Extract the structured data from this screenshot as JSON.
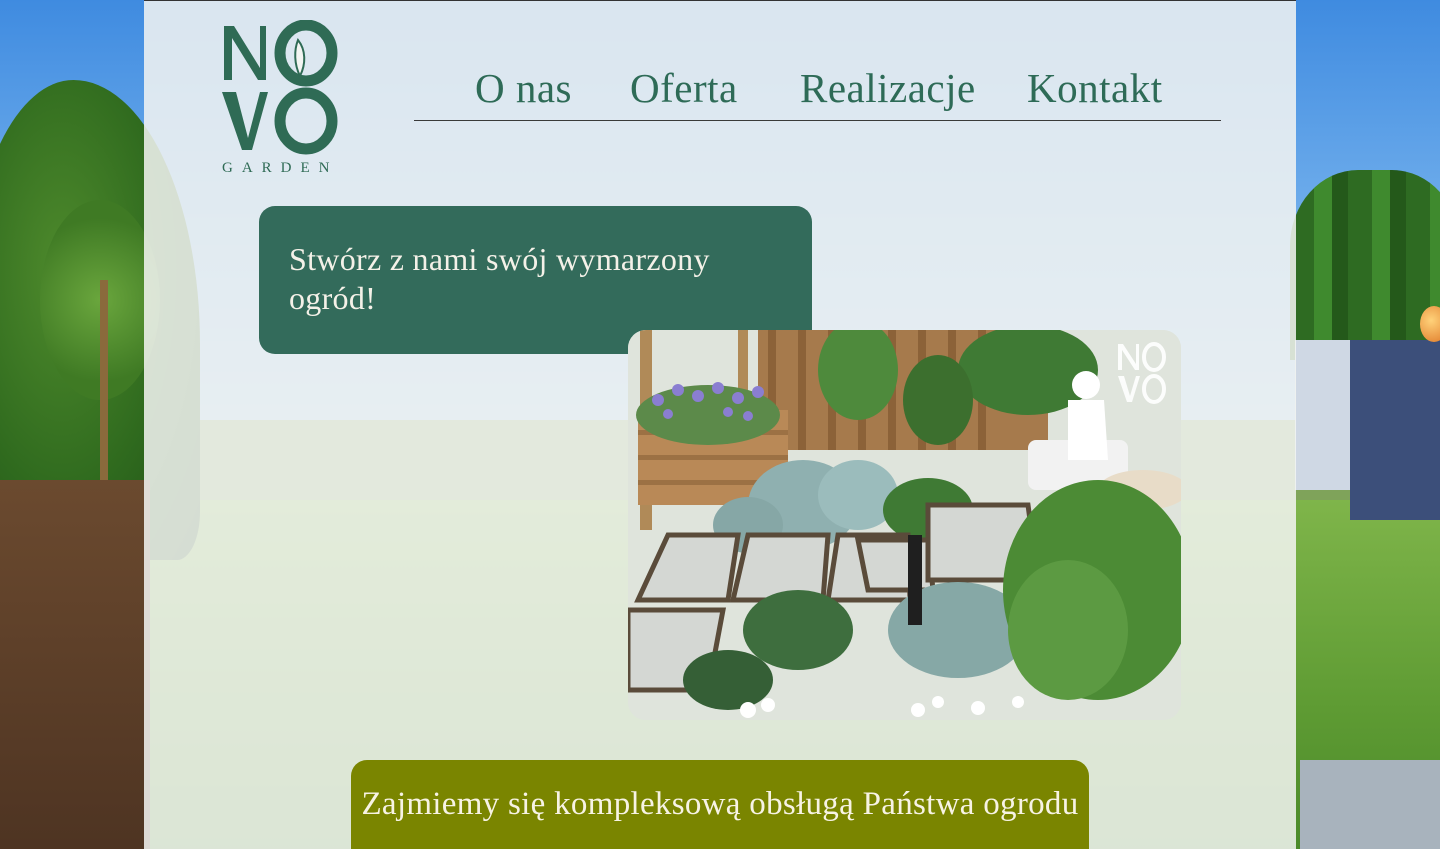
{
  "brand": {
    "logo_letters": "NOVO",
    "logo_tagline": "GARDEN"
  },
  "nav": {
    "items": [
      {
        "label": "O nas"
      },
      {
        "label": "Oferta"
      },
      {
        "label": "Realizacje"
      },
      {
        "label": "Kontakt"
      }
    ]
  },
  "hero": {
    "headline": "Stwórz z nami swój wymarzony ogród!"
  },
  "cta": {
    "label": "Zajmiemy się kompleksową obsługą Państwa ogrodu"
  },
  "colors": {
    "primary_green": "#336b5b",
    "logo_green": "#2f6b55",
    "olive_cta": "#7a8500",
    "panel_overlay": "#f3f5f2"
  },
  "icons": {
    "logo": "novo-garden-logo",
    "render_watermark": "novo-garden-watermark"
  }
}
